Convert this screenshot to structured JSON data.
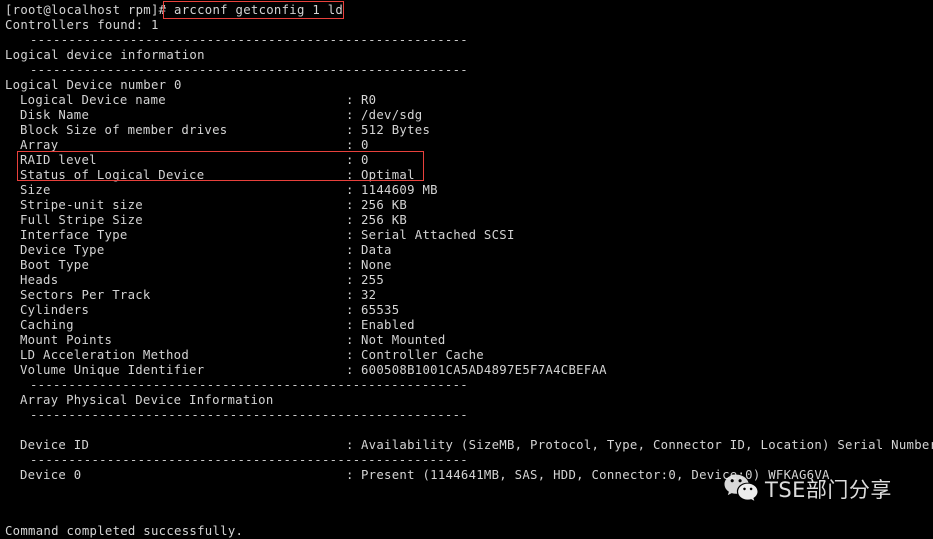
{
  "terminal": {
    "colors": {
      "background": "#000000",
      "text": "#d4d4d4",
      "highlight_box": "#e8413c"
    },
    "prompt": {
      "text": "[root@localhost rpm]# ",
      "command": "arcconf getconfig 1 ld"
    },
    "controllers_found": "Controllers found: 1",
    "rule": "---------------------------------------------------------",
    "short_rule": "---------------------------------------------------------",
    "sections": {
      "logical_device_information": "Logical device information",
      "array_physical_device_information": "Array Physical Device Information"
    },
    "logical_device_number": "Logical Device number 0",
    "logical_device_fields": [
      {
        "key": "Logical Device name",
        "value": "R0"
      },
      {
        "key": "Disk Name",
        "value": "/dev/sdg"
      },
      {
        "key": "Block Size of member drives",
        "value": "512 Bytes"
      },
      {
        "key": "Array",
        "value": "0"
      },
      {
        "key": "RAID level",
        "value": "0"
      },
      {
        "key": "Status of Logical Device",
        "value": "Optimal"
      },
      {
        "key": "Size",
        "value": "1144609 MB"
      },
      {
        "key": "Stripe-unit size",
        "value": "256 KB"
      },
      {
        "key": "Full Stripe Size",
        "value": "256 KB"
      },
      {
        "key": "Interface Type",
        "value": "Serial Attached SCSI"
      },
      {
        "key": "Device Type",
        "value": "Data"
      },
      {
        "key": "Boot Type",
        "value": "None"
      },
      {
        "key": "Heads",
        "value": "255"
      },
      {
        "key": "Sectors Per Track",
        "value": "32"
      },
      {
        "key": "Cylinders",
        "value": "65535"
      },
      {
        "key": "Caching",
        "value": "Enabled"
      },
      {
        "key": "Mount Points",
        "value": "Not Mounted"
      },
      {
        "key": "LD Acceleration Method",
        "value": "Controller Cache"
      },
      {
        "key": "Volume Unique Identifier",
        "value": "600508B1001CA5AD4897E5F7A4CBEFAA"
      }
    ],
    "physical_device_header": {
      "key": "Device ID",
      "value": "Availability (SizeMB, Protocol, Type, Connector ID, Location) Serial Number"
    },
    "physical_devices": [
      {
        "key": "Device 0",
        "value": "Present (1144641MB, SAS, HDD, Connector:0, Device:0) WFKAG6VA"
      }
    ],
    "final_message": "Command completed successfully."
  },
  "watermark": {
    "icon": "wechat-icon",
    "text": "TSE部门分享"
  }
}
